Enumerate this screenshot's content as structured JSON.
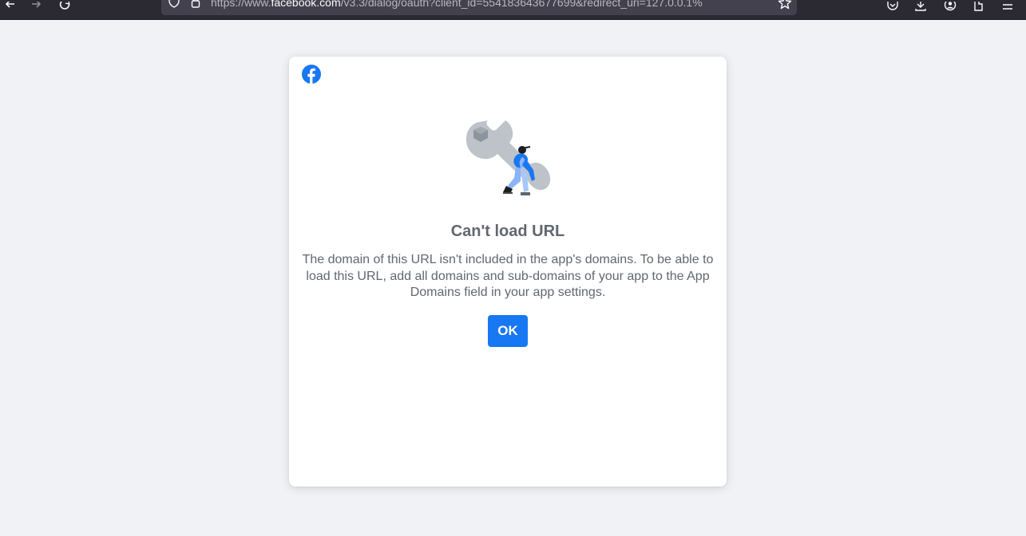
{
  "browser": {
    "url_prefix": "https://www.",
    "url_host": "facebook.com",
    "url_path": "/v3.3/dialog/oauth?client_id=554183643677699&redirect_uri=127.0.0.1%",
    "icons": [
      "back-icon",
      "forward-icon",
      "reload-icon",
      "shield-icon",
      "lock-icon",
      "star-icon",
      "pocket-icon",
      "download-icon",
      "account-icon",
      "extensions-icon",
      "menu-icon"
    ]
  },
  "dialog": {
    "brand_icon": "facebook-icon",
    "illustration": "wrench-mechanic-illustration",
    "title": "Can't load URL",
    "message": "The domain of this URL isn't included in the app's domains. To be able to load this URL, add all domains and sub-domains of your app to the App Domains field in your app settings.",
    "ok_label": "OK"
  },
  "colors": {
    "page_background": "#f0f2f5",
    "dialog_background": "#ffffff",
    "text": "#606770",
    "button": "#1877f2",
    "toolbar": "#2b2a33"
  }
}
